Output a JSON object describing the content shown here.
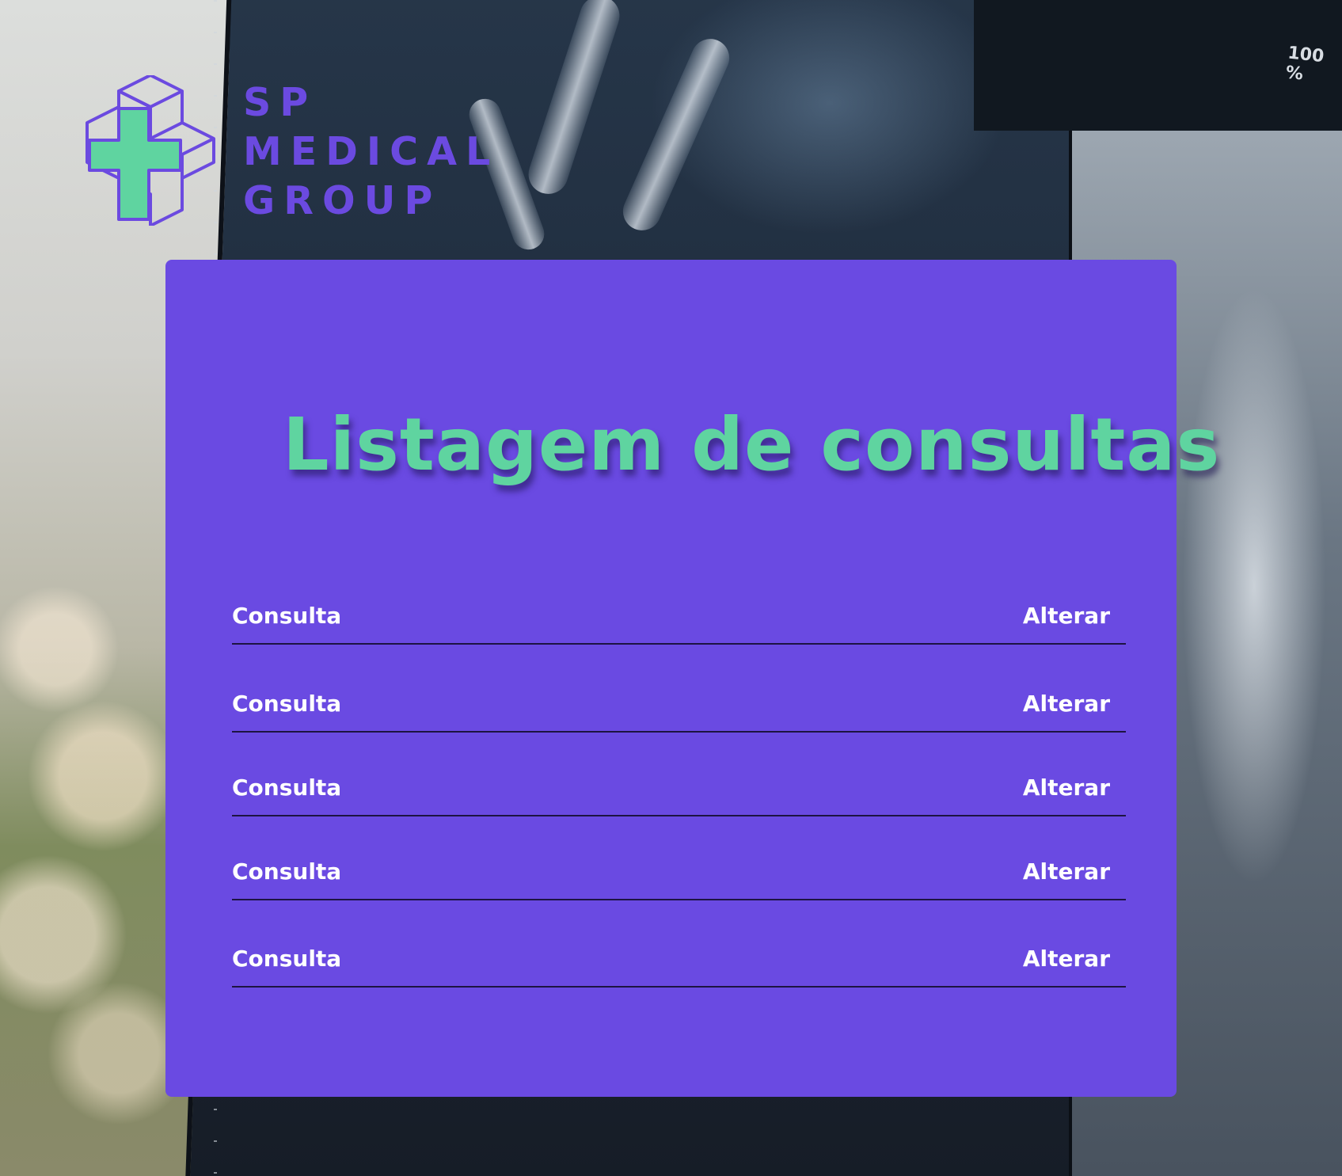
{
  "brand": {
    "line1": "SP",
    "line2": "MEDICAL",
    "line3": "GROUP",
    "primary_color": "#6a4ae2",
    "accent_color": "#5fd4a0"
  },
  "background": {
    "zoom_label": "100 %"
  },
  "page": {
    "title": "Listagem de consultas"
  },
  "consultas": [
    {
      "label": "Consulta",
      "action": "Alterar"
    },
    {
      "label": "Consulta",
      "action": "Alterar"
    },
    {
      "label": "Consulta",
      "action": "Alterar"
    },
    {
      "label": "Consulta",
      "action": "Alterar"
    },
    {
      "label": "Consulta",
      "action": "Alterar"
    }
  ]
}
